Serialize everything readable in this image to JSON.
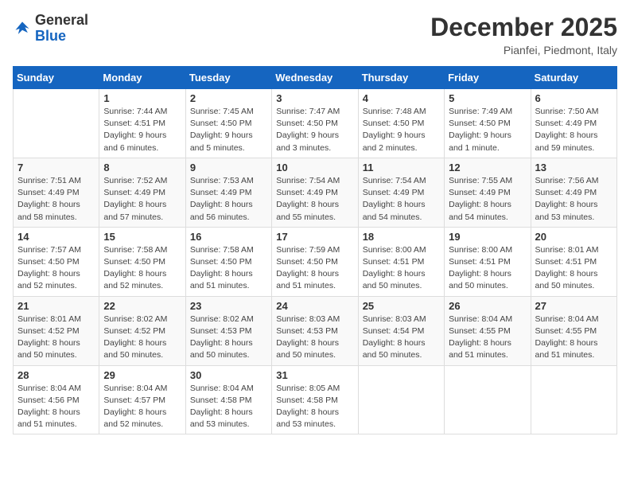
{
  "header": {
    "logo_general": "General",
    "logo_blue": "Blue",
    "month": "December 2025",
    "location": "Pianfei, Piedmont, Italy"
  },
  "days_of_week": [
    "Sunday",
    "Monday",
    "Tuesday",
    "Wednesday",
    "Thursday",
    "Friday",
    "Saturday"
  ],
  "weeks": [
    [
      {
        "day": "",
        "info": ""
      },
      {
        "day": "1",
        "info": "Sunrise: 7:44 AM\nSunset: 4:51 PM\nDaylight: 9 hours\nand 6 minutes."
      },
      {
        "day": "2",
        "info": "Sunrise: 7:45 AM\nSunset: 4:50 PM\nDaylight: 9 hours\nand 5 minutes."
      },
      {
        "day": "3",
        "info": "Sunrise: 7:47 AM\nSunset: 4:50 PM\nDaylight: 9 hours\nand 3 minutes."
      },
      {
        "day": "4",
        "info": "Sunrise: 7:48 AM\nSunset: 4:50 PM\nDaylight: 9 hours\nand 2 minutes."
      },
      {
        "day": "5",
        "info": "Sunrise: 7:49 AM\nSunset: 4:50 PM\nDaylight: 9 hours\nand 1 minute."
      },
      {
        "day": "6",
        "info": "Sunrise: 7:50 AM\nSunset: 4:49 PM\nDaylight: 8 hours\nand 59 minutes."
      }
    ],
    [
      {
        "day": "7",
        "info": "Sunrise: 7:51 AM\nSunset: 4:49 PM\nDaylight: 8 hours\nand 58 minutes."
      },
      {
        "day": "8",
        "info": "Sunrise: 7:52 AM\nSunset: 4:49 PM\nDaylight: 8 hours\nand 57 minutes."
      },
      {
        "day": "9",
        "info": "Sunrise: 7:53 AM\nSunset: 4:49 PM\nDaylight: 8 hours\nand 56 minutes."
      },
      {
        "day": "10",
        "info": "Sunrise: 7:54 AM\nSunset: 4:49 PM\nDaylight: 8 hours\nand 55 minutes."
      },
      {
        "day": "11",
        "info": "Sunrise: 7:54 AM\nSunset: 4:49 PM\nDaylight: 8 hours\nand 54 minutes."
      },
      {
        "day": "12",
        "info": "Sunrise: 7:55 AM\nSunset: 4:49 PM\nDaylight: 8 hours\nand 54 minutes."
      },
      {
        "day": "13",
        "info": "Sunrise: 7:56 AM\nSunset: 4:49 PM\nDaylight: 8 hours\nand 53 minutes."
      }
    ],
    [
      {
        "day": "14",
        "info": "Sunrise: 7:57 AM\nSunset: 4:50 PM\nDaylight: 8 hours\nand 52 minutes."
      },
      {
        "day": "15",
        "info": "Sunrise: 7:58 AM\nSunset: 4:50 PM\nDaylight: 8 hours\nand 52 minutes."
      },
      {
        "day": "16",
        "info": "Sunrise: 7:58 AM\nSunset: 4:50 PM\nDaylight: 8 hours\nand 51 minutes."
      },
      {
        "day": "17",
        "info": "Sunrise: 7:59 AM\nSunset: 4:50 PM\nDaylight: 8 hours\nand 51 minutes."
      },
      {
        "day": "18",
        "info": "Sunrise: 8:00 AM\nSunset: 4:51 PM\nDaylight: 8 hours\nand 50 minutes."
      },
      {
        "day": "19",
        "info": "Sunrise: 8:00 AM\nSunset: 4:51 PM\nDaylight: 8 hours\nand 50 minutes."
      },
      {
        "day": "20",
        "info": "Sunrise: 8:01 AM\nSunset: 4:51 PM\nDaylight: 8 hours\nand 50 minutes."
      }
    ],
    [
      {
        "day": "21",
        "info": "Sunrise: 8:01 AM\nSunset: 4:52 PM\nDaylight: 8 hours\nand 50 minutes."
      },
      {
        "day": "22",
        "info": "Sunrise: 8:02 AM\nSunset: 4:52 PM\nDaylight: 8 hours\nand 50 minutes."
      },
      {
        "day": "23",
        "info": "Sunrise: 8:02 AM\nSunset: 4:53 PM\nDaylight: 8 hours\nand 50 minutes."
      },
      {
        "day": "24",
        "info": "Sunrise: 8:03 AM\nSunset: 4:53 PM\nDaylight: 8 hours\nand 50 minutes."
      },
      {
        "day": "25",
        "info": "Sunrise: 8:03 AM\nSunset: 4:54 PM\nDaylight: 8 hours\nand 50 minutes."
      },
      {
        "day": "26",
        "info": "Sunrise: 8:04 AM\nSunset: 4:55 PM\nDaylight: 8 hours\nand 51 minutes."
      },
      {
        "day": "27",
        "info": "Sunrise: 8:04 AM\nSunset: 4:55 PM\nDaylight: 8 hours\nand 51 minutes."
      }
    ],
    [
      {
        "day": "28",
        "info": "Sunrise: 8:04 AM\nSunset: 4:56 PM\nDaylight: 8 hours\nand 51 minutes."
      },
      {
        "day": "29",
        "info": "Sunrise: 8:04 AM\nSunset: 4:57 PM\nDaylight: 8 hours\nand 52 minutes."
      },
      {
        "day": "30",
        "info": "Sunrise: 8:04 AM\nSunset: 4:58 PM\nDaylight: 8 hours\nand 53 minutes."
      },
      {
        "day": "31",
        "info": "Sunrise: 8:05 AM\nSunset: 4:58 PM\nDaylight: 8 hours\nand 53 minutes."
      },
      {
        "day": "",
        "info": ""
      },
      {
        "day": "",
        "info": ""
      },
      {
        "day": "",
        "info": ""
      }
    ]
  ]
}
